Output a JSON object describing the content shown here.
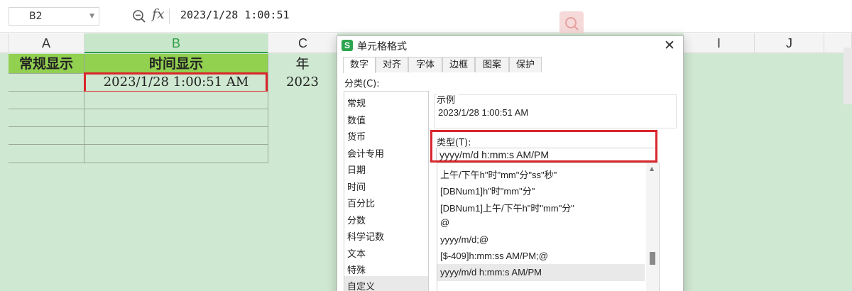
{
  "formula_bar": {
    "cell_ref": "B2",
    "formula": "2023/1/28 1:00:51"
  },
  "grid": {
    "columns": [
      "A",
      "B",
      "C",
      "I",
      "J"
    ],
    "selected_column": "B",
    "row_headers": [
      "常规显示",
      "时间显示",
      "年"
    ],
    "row_values": [
      "",
      "2023/1/28 1:00:51 AM",
      "2023"
    ]
  },
  "dialog": {
    "title": "单元格格式",
    "app_icon": "S",
    "tabs": [
      "数字",
      "对齐",
      "字体",
      "边框",
      "图案",
      "保护"
    ],
    "active_tab": "数字",
    "category_label": "分类(C):",
    "categories": [
      "常规",
      "数值",
      "货币",
      "会计专用",
      "日期",
      "时间",
      "百分比",
      "分数",
      "科学记数",
      "文本",
      "特殊",
      "自定义"
    ],
    "selected_category": "自定义",
    "example_label": "示例",
    "example_value": "2023/1/28 1:00:51 AM",
    "type_label": "类型(T):",
    "type_value": "yyyy/m/d h:mm:s AM/PM",
    "formats": [
      "上午/下午h\"时\"mm\"分\"ss\"秒\"",
      "[DBNum1]h\"时\"mm\"分\"",
      "[DBNum1]上午/下午h\"时\"mm\"分\"",
      "@",
      "yyyy/m/d;@",
      "[$-409]h:mm:ss AM/PM;@",
      "yyyy/m/d h:mm:s AM/PM"
    ],
    "selected_format": "yyyy/m/d h:mm:s AM/PM"
  },
  "colors": {
    "accent_green": "#2e9f4b",
    "header_fill": "#92d050",
    "grid_fill": "#cfe8d1",
    "highlight_red": "#d9262c"
  }
}
